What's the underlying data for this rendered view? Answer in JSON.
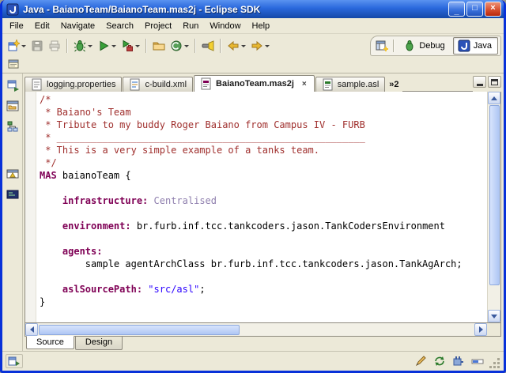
{
  "window": {
    "title": "Java - BaianoTeam/BaianoTeam.mas2j - Eclipse SDK",
    "controls": {
      "minimize": "_",
      "maximize": "□",
      "close": "×"
    }
  },
  "menu": [
    "File",
    "Edit",
    "Navigate",
    "Search",
    "Project",
    "Run",
    "Window",
    "Help"
  ],
  "toolbar": {
    "icon_names": [
      "new-wizard-icon",
      "save-icon",
      "print-icon",
      "debug-icon",
      "run-icon",
      "external-tools-icon",
      "new-java-project-icon",
      "new-class-icon",
      "search-icon",
      "back-icon",
      "forward-icon",
      "pin-editor-icon",
      "open-perspective-icon",
      "debug-perspective-icon",
      "java-perspective-icon"
    ]
  },
  "perspectives": {
    "debug": "Debug",
    "java": "Java"
  },
  "editor_tabs": {
    "items": [
      {
        "label": "logging.properties",
        "active": false
      },
      {
        "label": "c-build.xml",
        "active": false
      },
      {
        "label": "BaianoTeam.mas2j",
        "active": true
      },
      {
        "label": "sample.asl",
        "active": false
      }
    ],
    "close_glyph": "×",
    "overflow": "»2"
  },
  "editor": {
    "token_colors": {
      "comment": "#A0302E",
      "keyword": "#7F0055",
      "constant": "#8F7FAE",
      "string": "#2A00FF",
      "plain": "#000000"
    },
    "lines": [
      [
        {
          "t": "/*",
          "c": "c"
        }
      ],
      [
        {
          "t": " * Baiano's Team",
          "c": "c"
        }
      ],
      [
        {
          "t": " * Tribute to my buddy Roger Baiano from Campus IV - FURB",
          "c": "c"
        }
      ],
      [
        {
          "t": " * ______________________________________________________",
          "c": "c"
        }
      ],
      [
        {
          "t": " * This is a very simple example of a tanks team.",
          "c": "c"
        }
      ],
      [
        {
          "t": " */",
          "c": "c"
        }
      ],
      [
        {
          "t": "MAS",
          "c": "k"
        },
        {
          "t": " baianoTeam {",
          "c": "p"
        }
      ],
      [],
      [
        {
          "t": "    ",
          "c": "p"
        },
        {
          "t": "infrastructure:",
          "c": "k"
        },
        {
          "t": " ",
          "c": "p"
        },
        {
          "t": "Centralised",
          "c": "v"
        }
      ],
      [],
      [
        {
          "t": "    ",
          "c": "p"
        },
        {
          "t": "environment:",
          "c": "k"
        },
        {
          "t": " br.furb.inf.tcc.tankcoders.jason.TankCodersEnvironment",
          "c": "p"
        }
      ],
      [],
      [
        {
          "t": "    ",
          "c": "p"
        },
        {
          "t": "agents:",
          "c": "k"
        }
      ],
      [
        {
          "t": "        sample agentArchClass br.furb.inf.tcc.tankcoders.jason.TankAgArch;",
          "c": "p"
        }
      ],
      [],
      [
        {
          "t": "    ",
          "c": "p"
        },
        {
          "t": "aslSourcePath:",
          "c": "k"
        },
        {
          "t": " ",
          "c": "p"
        },
        {
          "t": "\"src/asl\"",
          "c": "s"
        },
        {
          "t": ";",
          "c": "p"
        }
      ],
      [
        {
          "t": "}",
          "c": "p"
        }
      ]
    ]
  },
  "page_tabs": {
    "source": "Source",
    "design": "Design"
  },
  "statusbar": {
    "icon_names": [
      "fast-view-bar-icon",
      "writable-status-icon",
      "sync-status-icon",
      "plugin-status-icon",
      "progress-status-icon"
    ]
  }
}
